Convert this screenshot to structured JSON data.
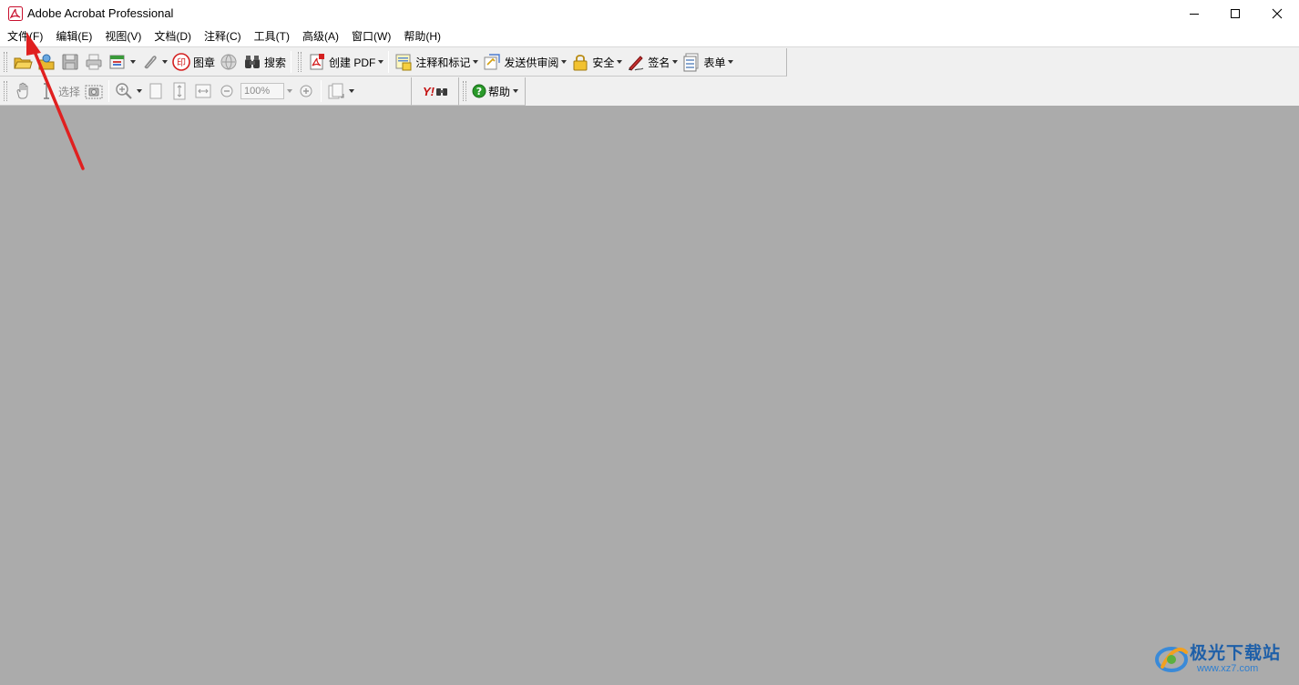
{
  "window": {
    "title": "Adobe Acrobat Professional",
    "icon": "acrobat-app-icon",
    "controls": [
      "minimize-icon",
      "maximize-icon",
      "close-icon"
    ]
  },
  "menubar": {
    "items": [
      "文件(F)",
      "编辑(E)",
      "视图(V)",
      "文档(D)",
      "注释(C)",
      "工具(T)",
      "高级(A)",
      "窗口(W)",
      "帮助(H)"
    ]
  },
  "toolbar1": {
    "stamp_label": "图章",
    "search_label": "搜索",
    "create_pdf_label": "创建 PDF",
    "comment_label": "注释和标记",
    "review_label": "发送供审阅",
    "security_label": "安全",
    "sign_label": "签名",
    "forms_label": "表单"
  },
  "toolbar2": {
    "select_label": "选择",
    "zoom_value": "100%",
    "yahoo_label": "Y!",
    "help_label": "帮助"
  },
  "watermark": {
    "title": "极光下载站",
    "url": "www.xz7.com"
  },
  "colors": {
    "doc_background": "#ababab",
    "toolbar_background": "#f0f0f0",
    "annotation_arrow": "#e02020",
    "stamp_red": "#d42020",
    "help_green": "#2a9a2a"
  }
}
